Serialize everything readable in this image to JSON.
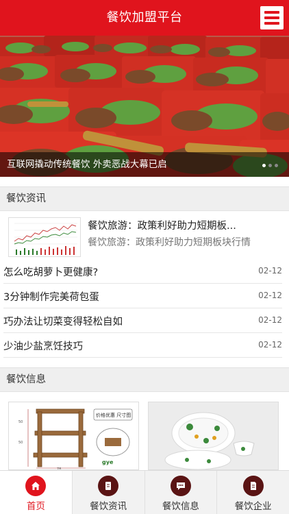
{
  "header": {
    "title": "餐饮加盟平台",
    "menu_icon": "hamburger-menu-icon",
    "brand_color": "#e0141d"
  },
  "banner": {
    "caption": "互联网撬动传统餐饮 外卖恶战大幕已启",
    "slide_count": 3,
    "active_slide": 1
  },
  "news_section": {
    "title": "餐饮资讯",
    "featured": {
      "title": "餐饮旅游：政策利好助力短期板...",
      "summary": "餐饮旅游：政策利好助力短期板块行情"
    },
    "items": [
      {
        "title": "怎么吃胡萝卜更健康?",
        "date": "02-12"
      },
      {
        "title": "3分钟制作完美荷包蛋",
        "date": "02-12"
      },
      {
        "title": "巧办法让切菜变得轻松自如",
        "date": "02-12"
      },
      {
        "title": "少油少盐烹饪技巧",
        "date": "02-12"
      }
    ]
  },
  "info_section": {
    "title": "餐饮信息",
    "card1_badge": "价格优惠 尺寸图",
    "card1_brand": "gye"
  },
  "tabbar": {
    "tabs": [
      {
        "label": "首页",
        "icon": "home-icon",
        "active": true
      },
      {
        "label": "餐饮资讯",
        "icon": "document-icon",
        "active": false
      },
      {
        "label": "餐饮信息",
        "icon": "chat-bubble-icon",
        "active": false
      },
      {
        "label": "餐饮企业",
        "icon": "file-icon",
        "active": false
      }
    ]
  }
}
